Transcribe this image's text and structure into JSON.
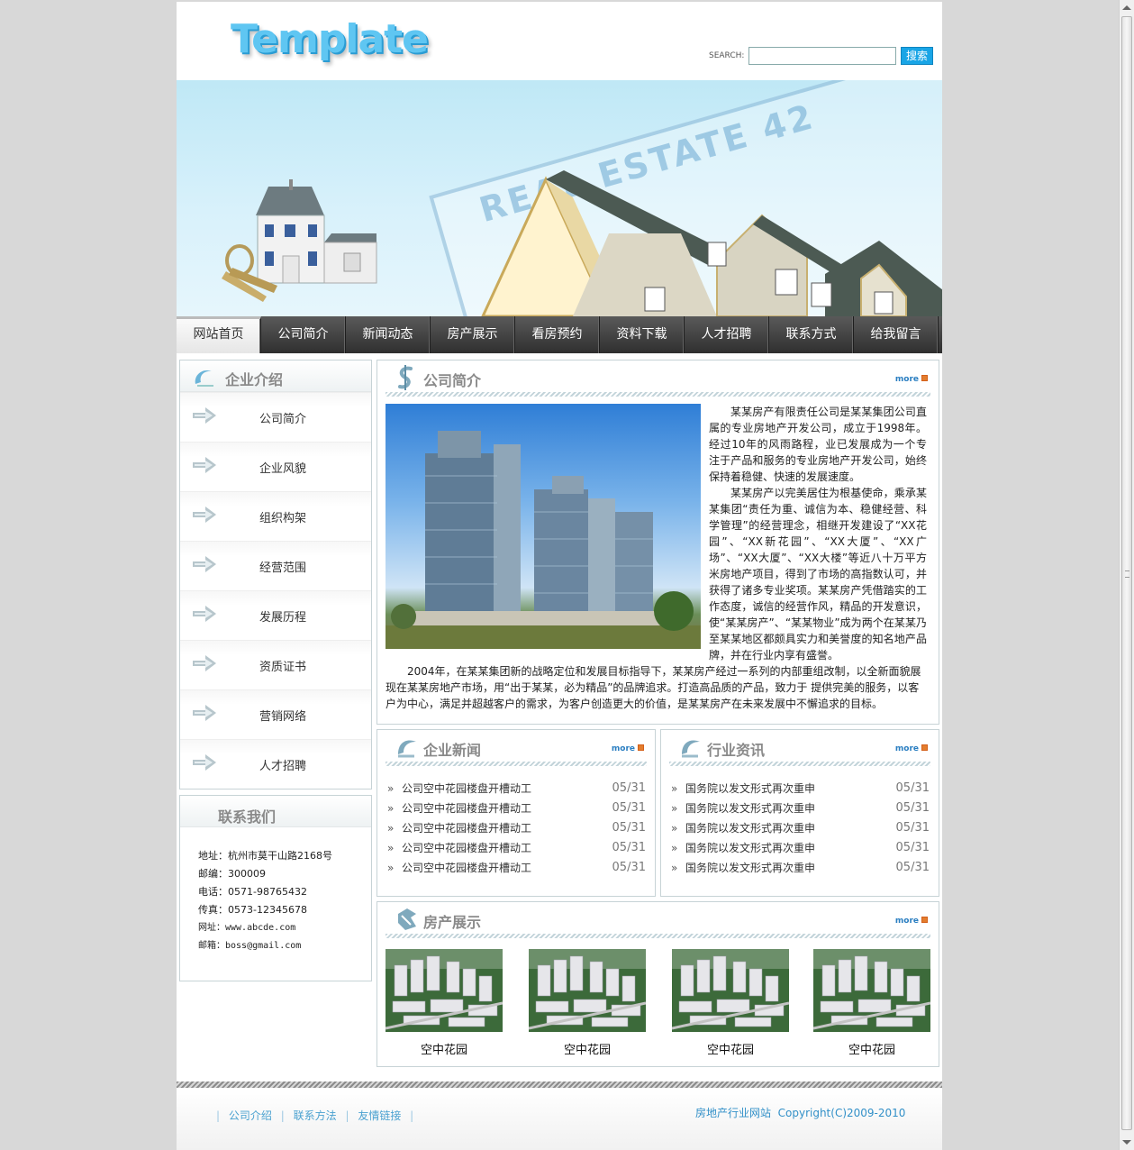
{
  "header": {
    "logo_text": "Template",
    "search_label": "SEARCH:",
    "search_value": "",
    "search_button": "搜索"
  },
  "banner": {
    "text": "REAL ESTATE 42"
  },
  "nav": [
    "网站首页",
    "公司简介",
    "新闻动态",
    "房产展示",
    "看房预约",
    "资料下载",
    "人才招聘",
    "联系方式",
    "给我留言"
  ],
  "sidebar": {
    "title": "企业介绍",
    "items": [
      "公司简介",
      "企业风貌",
      "组织构架",
      "经营范围",
      "发展历程",
      "资质证书",
      "营销网络",
      "人才招聘"
    ]
  },
  "contact": {
    "title": "联系我们",
    "lines": [
      "地址：杭州市莫干山路2168号",
      "邮编：300009",
      "电话：0571-98765432",
      "传真：0573-12345678",
      "网址：www.abcde.com",
      "邮箱：boss@gmail.com"
    ]
  },
  "intro": {
    "title": "公司简介",
    "more": "more",
    "paragraphs": [
      "某某房产有限责任公司是某某集团公司直属的专业房地产开发公司，成立于1998年。经过10年的风雨路程，业已发展成为一个专注于产品和服务的专业房地产开发公司，始终保持着稳健、快速的发展速度。",
      "某某房产以完美居住为根基使命，乘承某某集团“责任为重、诚信为本、稳健经营、科学管理”的经营理念，相继开发建设了“XX花园”、“XX新花园”、“XX大厦”、“XX广场”、“XX大厦”、“XX大楼”等近八十万平方米房地产项目，得到了市场的高指数认可，并获得了诸多专业奖项。某某房产凭借踏实的工作态度，诚信的经营作风，精品的开发意识，使“某某房产”、“某某物业”成为两个在某某乃至某某地区都颇具实力和美誉度的知名地产品牌，并在行业内享有盛誉。",
      "2004年，在某某集团新的战略定位和发展目标指导下，某某房产经过一系列的内部重组改制，以全新面貌展现在某某房地产市场，用“出于某某，必为精品”的品牌追求。打造高品质的产品，致力于 提供完美的服务，以客户为中心，满足并超越客户的需求，为客户创造更大的价值，是某某房产在未来发展中不懈追求的目标。"
    ]
  },
  "news_company": {
    "title": "企业新闻",
    "more": "more",
    "items": [
      {
        "text": "公司空中花园楼盘开槽动工",
        "date": "05/31"
      },
      {
        "text": "公司空中花园楼盘开槽动工",
        "date": "05/31"
      },
      {
        "text": "公司空中花园楼盘开槽动工",
        "date": "05/31"
      },
      {
        "text": "公司空中花园楼盘开槽动工",
        "date": "05/31"
      },
      {
        "text": "公司空中花园楼盘开槽动工",
        "date": "05/31"
      }
    ]
  },
  "news_industry": {
    "title": "行业资讯",
    "more": "more",
    "items": [
      {
        "text": "国务院以发文形式再次重申",
        "date": "05/31"
      },
      {
        "text": "国务院以发文形式再次重申",
        "date": "05/31"
      },
      {
        "text": "国务院以发文形式再次重申",
        "date": "05/31"
      },
      {
        "text": "国务院以发文形式再次重申",
        "date": "05/31"
      },
      {
        "text": "国务院以发文形式再次重申",
        "date": "05/31"
      }
    ]
  },
  "property": {
    "title": "房产展示",
    "more": "more",
    "items": [
      "空中花园",
      "空中花园",
      "空中花园",
      "空中花园"
    ]
  },
  "footer": {
    "links": [
      "公司介绍",
      "联系方法",
      "友情链接"
    ],
    "copyright": "房地产行业网站  Copyright(C)2009-2010"
  },
  "colors": {
    "accent": "#19a5e6",
    "nav_bg": "#3a3a3a",
    "link": "#3290c8"
  }
}
